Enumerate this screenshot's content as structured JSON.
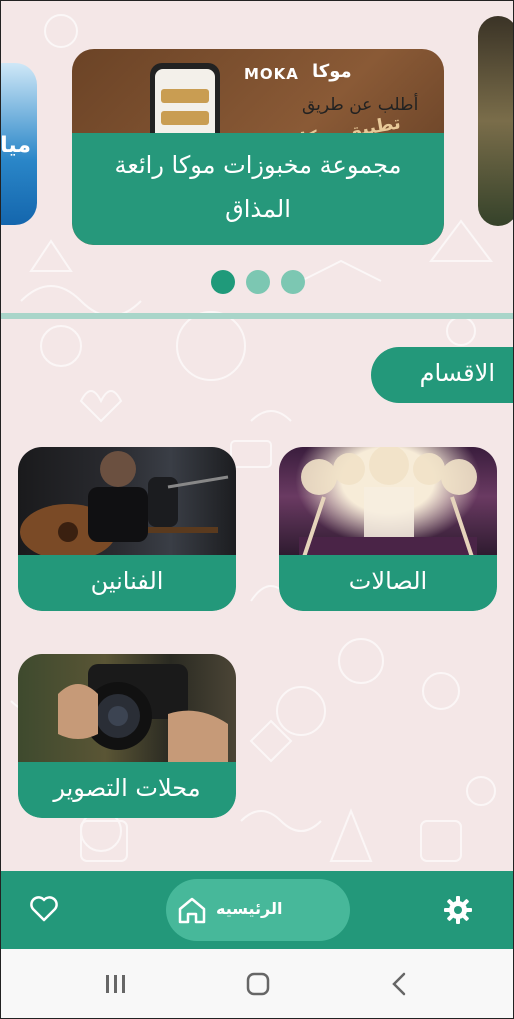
{
  "carousel": {
    "main_caption": "مجموعة مخبوزات موكا رائعة المذاق",
    "main_image_brand": "MOKA",
    "main_image_brand_ar": "موكا",
    "main_image_line1": "أطلب عن طريق",
    "main_image_line2": "تطبيق موكا",
    "left_card_partial": "ميا",
    "pages": 3,
    "active_page": 0
  },
  "section": {
    "title": "الاقسام"
  },
  "categories": [
    {
      "label": "الصالات"
    },
    {
      "label": "الفنانين"
    },
    {
      "label": "محلات التصوير"
    }
  ],
  "bottom_nav": {
    "home_label": "الرئيسيه"
  },
  "colors": {
    "primary": "#23987a",
    "background": "#f4e7e7",
    "accent_light": "#47b89a"
  },
  "icons": [
    "settings-icon",
    "home-icon",
    "heart-icon",
    "recent-apps-icon",
    "home-button-icon",
    "back-icon"
  ]
}
